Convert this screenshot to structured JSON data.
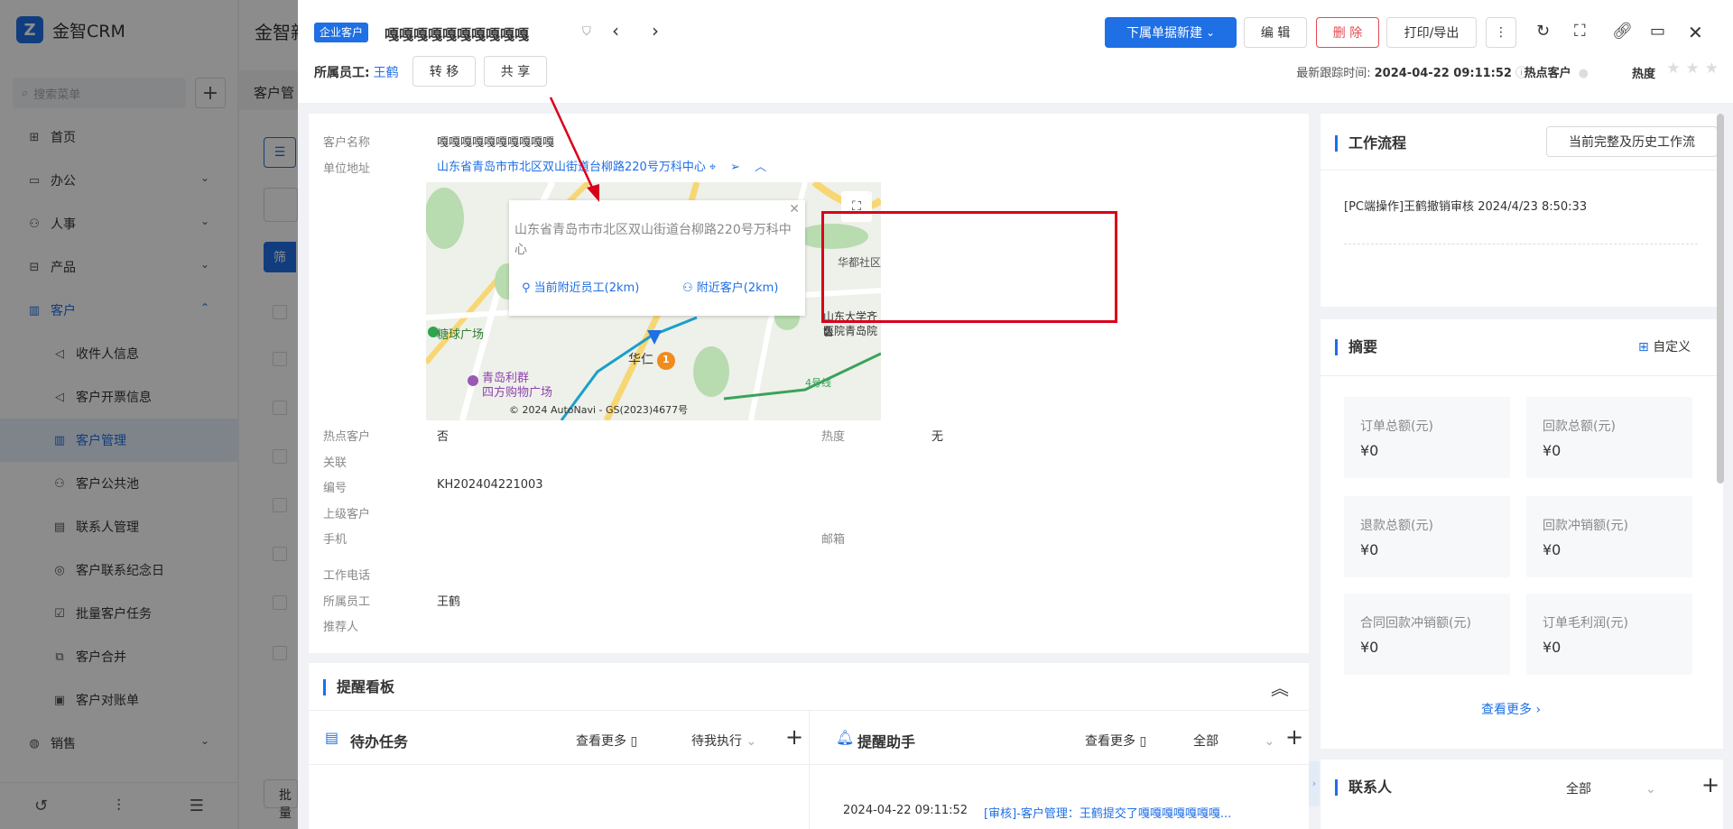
{
  "sidebar": {
    "brand": "金智CRM",
    "search_placeholder": "搜索菜单",
    "items": [
      {
        "label": "首页",
        "icon": "home-icon"
      },
      {
        "label": "办公",
        "icon": "office-icon"
      },
      {
        "label": "人事",
        "icon": "people-icon"
      },
      {
        "label": "产品",
        "icon": "product-icon"
      },
      {
        "label": "客户",
        "icon": "customer-icon"
      },
      {
        "label": "收件人信息",
        "icon": "mailbox-icon"
      },
      {
        "label": "客户开票信息",
        "icon": "invoice-icon"
      },
      {
        "label": "客户管理",
        "icon": "customer-manage-icon"
      },
      {
        "label": "客户公共池",
        "icon": "pool-icon"
      },
      {
        "label": "联系人管理",
        "icon": "contact-icon"
      },
      {
        "label": "客户联系纪念日",
        "icon": "calendar-icon"
      },
      {
        "label": "批量客户任务",
        "icon": "task-icon"
      },
      {
        "label": "客户合并",
        "icon": "merge-icon"
      },
      {
        "label": "客户对账单",
        "icon": "statement-icon"
      },
      {
        "label": "销售",
        "icon": "sales-icon"
      }
    ]
  },
  "background": {
    "page_title": "金智新",
    "tab": "客户管",
    "filter_button": "筛",
    "batch_button": "批量"
  },
  "header": {
    "tag": "企业客户",
    "title": "嘎嘎嘎嘎嘎嘎嘎嘎嘎嘎",
    "new_sub_button": "下属单据新建",
    "edit_button": "编 辑",
    "delete_button": "删 除",
    "print_button": "打印/导出",
    "owner_label": "所属员工:",
    "owner_name": "王鹤",
    "transfer_button": "转 移",
    "share_button": "共 享",
    "track_label": "最新跟踪时间:",
    "track_time": "2024-04-22 09:11:52",
    "hot_label": "热点客户",
    "heat_label": "热度",
    "stars_total": 3,
    "stars_filled": 0
  },
  "detail": {
    "name_label": "客户名称",
    "name_value": "嘎嘎嘎嘎嘎嘎嘎嘎嘎嘎",
    "addr_label": "单位地址",
    "addr_value": "山东省青岛市市北区双山街道台柳路220号万科中心",
    "hot_label": "热点客户",
    "hot_value": "否",
    "heat_label": "热度",
    "heat_value": "无",
    "related_label": "关联",
    "code_label": "编号",
    "code_value": "KH202404221003",
    "parent_label": "上级客户",
    "mobile_label": "手机",
    "email_label": "邮箱",
    "workphone_label": "工作电话",
    "owner_label": "所属员工",
    "owner_value": "王鹤",
    "referrer_label": "推荐人"
  },
  "map": {
    "popup_text": "山东省青岛市市北区双山街道台柳路220号万科中心",
    "nearby_staff": "当前附近员工(2km)",
    "nearby_customers": "附近客户(2km)",
    "copyright": "© 2024 AutoNavi - GS(2023)4677号",
    "labels": [
      "糖球广场",
      "青岛利群",
      "四方购物广场",
      "华仁",
      "华都社区",
      "山东大学齐鲁",
      "医院青岛院",
      "4号线"
    ],
    "marker_number": "1"
  },
  "remind": {
    "title": "提醒看板",
    "todo_title": "待办任务",
    "todo_more": "查看更多",
    "todo_filter": "待我执行",
    "assist_title": "提醒助手",
    "assist_more": "查看更多",
    "assist_filter": "全部",
    "entry_time": "2024-04-22 09:11:52",
    "entry_text": "[审核]-客户管理：王鹤提交了嘎嘎嘎嘎嘎嘎嘎..."
  },
  "workflow": {
    "title": "工作流程",
    "history_button": "当前完整及历史工作流",
    "entry": "[PC端操作]王鹤撤销审核 2024/4/23 8:50:33"
  },
  "summary": {
    "title": "摘要",
    "customize": "自定义",
    "items": [
      {
        "label": "订单总额(元)",
        "value": "¥0"
      },
      {
        "label": "回款总额(元)",
        "value": "¥0"
      },
      {
        "label": "退款总额(元)",
        "value": "¥0"
      },
      {
        "label": "回款冲销额(元)",
        "value": "¥0"
      },
      {
        "label": "合同回款冲销额(元)",
        "value": "¥0"
      },
      {
        "label": "订单毛利润(元)",
        "value": "¥0"
      }
    ],
    "more": "查看更多"
  },
  "contacts": {
    "title": "联系人",
    "filter": "全部"
  },
  "colors": {
    "accent": "#1f6fe5",
    "danger": "#e5484d",
    "annotation": "#d9001b"
  }
}
